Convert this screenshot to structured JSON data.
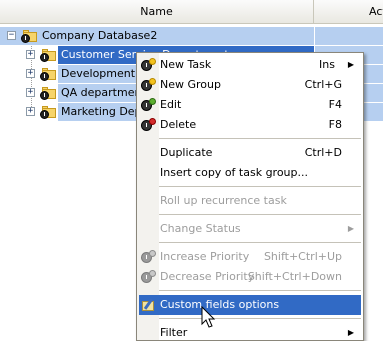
{
  "header": {
    "name_label": "Name",
    "act_label": "Act"
  },
  "tree": {
    "root": {
      "label": "Company Database2",
      "expander": "−"
    },
    "children": [
      {
        "label": "Customer Service Department",
        "expander": "+"
      },
      {
        "label": "Development department",
        "expander": "+"
      },
      {
        "label": "QA department",
        "expander": "+"
      },
      {
        "label": "Marketing Department",
        "expander": "+"
      }
    ]
  },
  "context_menu": {
    "items": [
      {
        "label": "New Task",
        "shortcut": "Ins",
        "submenu": true,
        "icon": "new-task-icon",
        "enabled": true
      },
      {
        "label": "New Group",
        "shortcut": "Ctrl+G",
        "icon": "new-group-icon",
        "enabled": true
      },
      {
        "label": "Edit",
        "shortcut": "F4",
        "icon": "edit-icon",
        "enabled": true
      },
      {
        "label": "Delete",
        "shortcut": "F8",
        "icon": "delete-icon",
        "enabled": true
      },
      {
        "label": "Duplicate",
        "shortcut": "Ctrl+D",
        "enabled": true
      },
      {
        "label": "Insert copy of task group...",
        "enabled": true
      },
      {
        "label": "Roll up recurrence task",
        "enabled": false
      },
      {
        "label": "Change Status",
        "submenu": true,
        "enabled": false
      },
      {
        "label": "Increase Priority",
        "shortcut": "Shift+Ctrl+Up",
        "icon": "increase-priority-icon",
        "enabled": false
      },
      {
        "label": "Decrease Priority",
        "shortcut": "Shift+Ctrl+Down",
        "icon": "decrease-priority-icon",
        "enabled": false
      },
      {
        "label": "Custom fields options",
        "icon": "custom-fields-icon",
        "enabled": true,
        "highlighted": true
      },
      {
        "label": "Filter",
        "submenu": true,
        "enabled": true
      }
    ]
  },
  "colors": {
    "selection": "#316ac5",
    "row_highlight": "#b6cff0",
    "disabled_text": "#9d9d9d"
  }
}
